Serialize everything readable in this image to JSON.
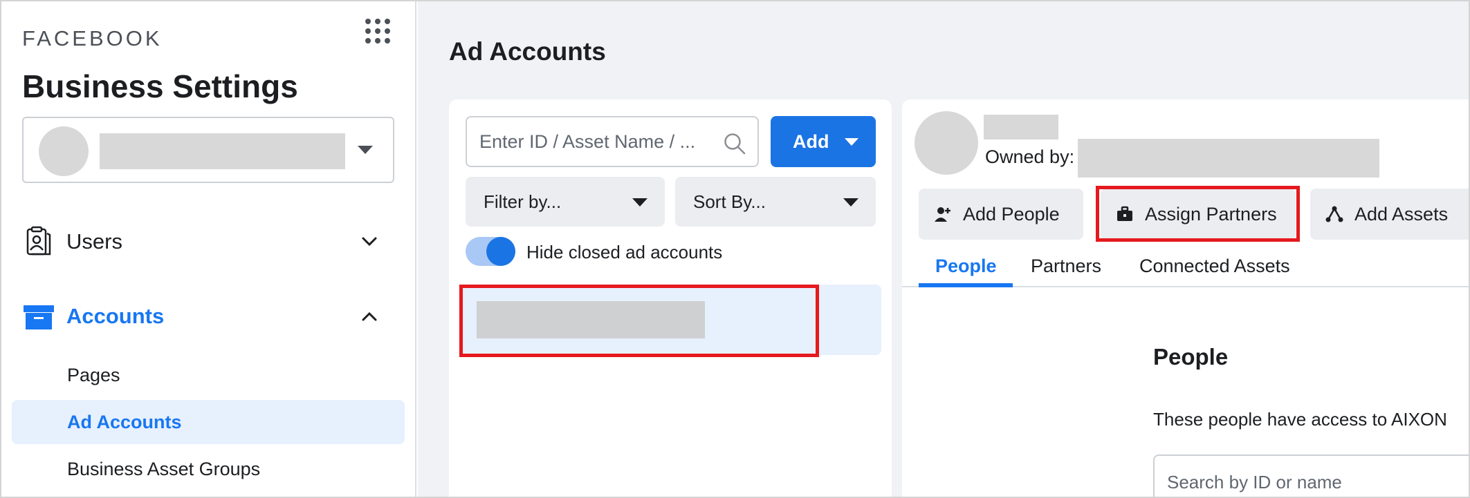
{
  "brand": {
    "wordmark": "FACEBOOK",
    "title": "Business Settings"
  },
  "sidebar": {
    "items": [
      {
        "label": "Users",
        "icon": "id-badge-icon",
        "expanded": false
      },
      {
        "label": "Accounts",
        "icon": "archive-box-icon",
        "expanded": true,
        "active": true
      }
    ],
    "subitems": [
      {
        "label": "Pages"
      },
      {
        "label": "Ad Accounts",
        "active": true
      },
      {
        "label": "Business Asset Groups"
      }
    ]
  },
  "main": {
    "title": "Ad Accounts",
    "search": {
      "placeholder": "Enter ID / Asset Name / ...",
      "value": ""
    },
    "add_label": "Add",
    "filter_label": "Filter by...",
    "sort_label": "Sort By...",
    "toggle": {
      "label": "Hide closed ad accounts",
      "on": true
    }
  },
  "detail": {
    "owned_label": "Owned by:",
    "actions": [
      {
        "label": "Add People",
        "icon": "add-person-icon"
      },
      {
        "label": "Assign Partners",
        "icon": "briefcase-icon"
      },
      {
        "label": "Add Assets",
        "icon": "share-nodes-icon"
      }
    ],
    "tabs": [
      {
        "label": "People",
        "active": true
      },
      {
        "label": "Partners"
      },
      {
        "label": "Connected Assets"
      }
    ],
    "section_title": "People",
    "section_desc": "These people have access to AIXON",
    "people_search_placeholder": "Search by ID or name"
  },
  "colors": {
    "accent": "#1877f2",
    "button_primary": "#1b74e4",
    "highlight": "#e5191e",
    "selected_bg": "#e7f0fd",
    "main_bg": "#f0f2f5"
  }
}
